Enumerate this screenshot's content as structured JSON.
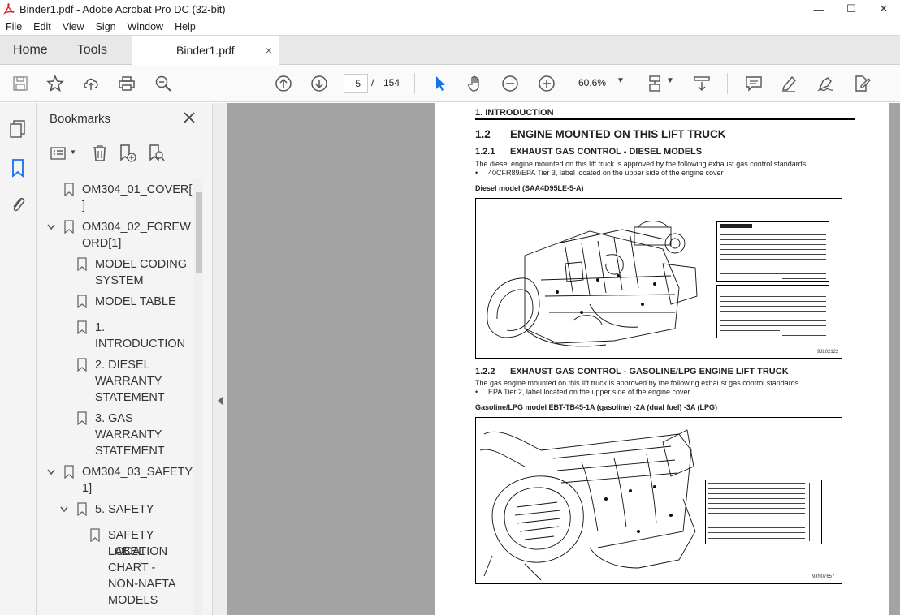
{
  "window": {
    "title": "Binder1.pdf - Adobe Acrobat Pro DC (32-bit)",
    "controls": [
      "—",
      "☐",
      "✕"
    ]
  },
  "menu": [
    "File",
    "Edit",
    "View",
    "Sign",
    "Window",
    "Help"
  ],
  "tabs": {
    "home": "Home",
    "tools": "Tools",
    "document": "Binder1.pdf",
    "close": "×"
  },
  "toolbar": {
    "page_current": "5",
    "page_separator": "/",
    "page_total": "154",
    "zoom": "60.6%",
    "icons": [
      "save-icon",
      "star-icon",
      "upload-icon",
      "print-icon",
      "zoom-search-icon",
      "page-up-icon",
      "page-down-icon",
      "select-arrow-icon",
      "hand-icon",
      "zoom-out-icon",
      "zoom-in-icon",
      "fit-page-icon",
      "scroll-mode-icon",
      "comment-icon",
      "highlight-icon",
      "sign-icon",
      "edit-pdf-icon"
    ]
  },
  "bookmarks": {
    "title": "Bookmarks",
    "items": [
      {
        "text1": "OM304_01_COVER[1",
        "text2": "]"
      },
      {
        "text1": "OM304_02_FOREW",
        "text2": "ORD[1]"
      },
      {
        "text1": "MODEL CODING",
        "text2": "SYSTEM"
      },
      {
        "text1": "MODEL TABLE",
        "text2": ""
      },
      {
        "text1": "1.",
        "text2": "INTRODUCTION"
      },
      {
        "text1": "2. DIESEL",
        "text2": "WARRANTY",
        "text3": "STATEMENT"
      },
      {
        "text1": "3. GAS",
        "text2": "WARRANTY",
        "text3": "STATEMENT"
      },
      {
        "text1": "OM304_03_SAFETY[",
        "text2": "1]"
      },
      {
        "text1": "5. SAFETY",
        "text2": ""
      },
      {
        "text1": "SAFETY LABEL",
        "text2": "LOCATION",
        "text3": "CHART -",
        "text4": "NON-NAFTA",
        "text5": "MODELS"
      }
    ]
  },
  "document": {
    "header": "1. INTRODUCTION",
    "section_num": "1.2",
    "section_title": "ENGINE MOUNTED ON THIS LIFT TRUCK",
    "sub1_num": "1.2.1",
    "sub1_title": "EXHAUST GAS CONTROL - DIESEL MODELS",
    "sub1_para": "The diesel engine mounted on this lift truck is approved by the following exhaust gas control standards.",
    "sub1_bullet": "40CFR89/EPA Tier 3, label located on the upper side of the engine cover",
    "sub1_caption": "Diesel model (SAA4D95LE-5-A)",
    "fig1_code": "9JL02122",
    "sub2_num": "1.2.2",
    "sub2_title": "EXHAUST GAS CONTROL - GASOLINE/LPG ENGINE LIFT TRUCK",
    "sub2_para": "The gas engine mounted on this lift truck is approved by the following exhaust gas control standards.",
    "sub2_bullet": "EPA Tier 2, label located on the upper side of the engine cover",
    "sub2_caption": "Gasoline/LPG model EBT-TB45-1A (gasoline) -2A (dual fuel) -3A (LPG)",
    "fig2_code": "9JN07657",
    "label1_lines": [
      "Komatsu Ltd.",
      "Engine Model SAA4D95LE-5 EPA XXXXXXXX",
      "EPA Cert. Family-XXXXXXXXXXXX",
      "EU Approval NO. XXXXXXXXXXXXXXXXXXXXXX",
      "Gross Rated HP/KW XX/XX at XXXXrpm",
      "Engine Code XXX   Low Idel RPM XXX rpm",
      "Timing BTDC XXdeg  Displacement 3.26LL",
      "Valve Lash Cold   In 0.35mm Ex 0.50mm",
      "Fuel Rate at Rated HP/KW XXXmm3/st",
      "Date of Manufacture XXXX XX XX",
      "Made in Japan   6271-81-7541"
    ],
    "label1_warning_title": "IMPORTANT ENGINE INFORMATION",
    "label1_warning_code": "6204-81-2580",
    "label2_title": "EMISSION CONTROL INFORMATION",
    "label2_footer": "NISSAN MOTOR CO. LTD.   TB45D"
  }
}
